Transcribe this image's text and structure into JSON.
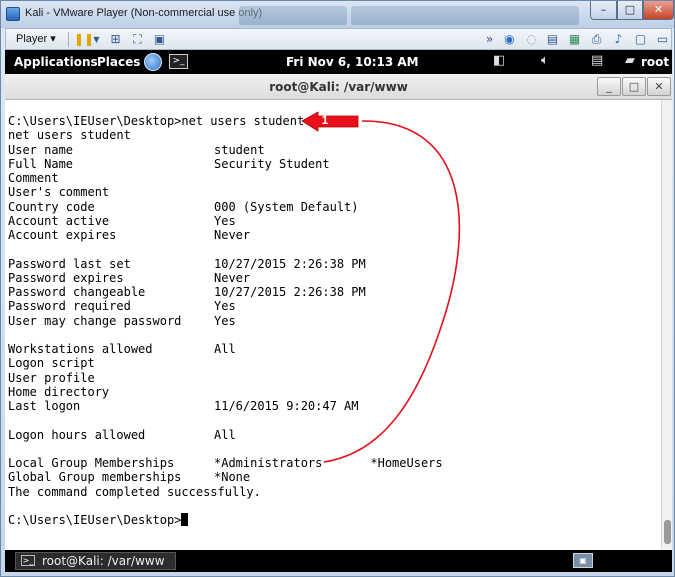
{
  "window": {
    "title": "Kali - VMware Player (Non-commercial use only)",
    "minimize_glyph": "–",
    "maximize_glyph": "□",
    "close_glyph": "✕"
  },
  "toolbar": {
    "player_label": "Player ▾",
    "icons": [
      "pause-icon",
      "network-icon",
      "fullscreen-icon",
      "unity-icon",
      "forward-icon",
      "cd-icon",
      "floppy-icon",
      "drive-icon",
      "printer-icon",
      "audio-icon",
      "usb-icon",
      "message-icon"
    ]
  },
  "kali_panel": {
    "applications": "Applications",
    "places": "Places",
    "clock": "Fri Nov  6, 10:13 AM",
    "user": "root"
  },
  "terminal": {
    "title": "root@Kali: /var/www",
    "min_glyph": "_",
    "max_glyph": "□",
    "close_glyph": "✕",
    "prompt_line": "C:\\Users\\IEUser\\Desktop>net users student",
    "echo_line": "net users student",
    "rows": [
      {
        "key": "User name",
        "value": "student"
      },
      {
        "key": "Full Name",
        "value": "Security Student"
      },
      {
        "key": "Comment",
        "value": ""
      },
      {
        "key": "User's comment",
        "value": ""
      },
      {
        "key": "Country code",
        "value": "000 (System Default)"
      },
      {
        "key": "Account active",
        "value": "Yes"
      },
      {
        "key": "Account expires",
        "value": "Never"
      },
      {
        "key": "",
        "value": ""
      },
      {
        "key": "Password last set",
        "value": "10/27/2015 2:26:38 PM"
      },
      {
        "key": "Password expires",
        "value": "Never"
      },
      {
        "key": "Password changeable",
        "value": "10/27/2015 2:26:38 PM"
      },
      {
        "key": "Password required",
        "value": "Yes"
      },
      {
        "key": "User may change password",
        "value": "Yes"
      },
      {
        "key": "",
        "value": ""
      },
      {
        "key": "Workstations allowed",
        "value": "All"
      },
      {
        "key": "Logon script",
        "value": ""
      },
      {
        "key": "User profile",
        "value": ""
      },
      {
        "key": "Home directory",
        "value": ""
      },
      {
        "key": "Last logon",
        "value": "11/6/2015 9:20:47 AM"
      },
      {
        "key": "",
        "value": ""
      },
      {
        "key": "Logon hours allowed",
        "value": "All"
      },
      {
        "key": "",
        "value": ""
      },
      {
        "key": "Local Group Memberships",
        "value": "*Administrators",
        "value2": "*HomeUsers"
      },
      {
        "key": "Global Group memberships",
        "value": "*None"
      }
    ],
    "completed_line": "The command completed successfully.",
    "final_prompt": "C:\\Users\\IEUser\\Desktop>"
  },
  "taskbar": {
    "task_label": "root@Kali: /var/www"
  },
  "annotation": {
    "label": "1",
    "color": "#e8101a"
  }
}
